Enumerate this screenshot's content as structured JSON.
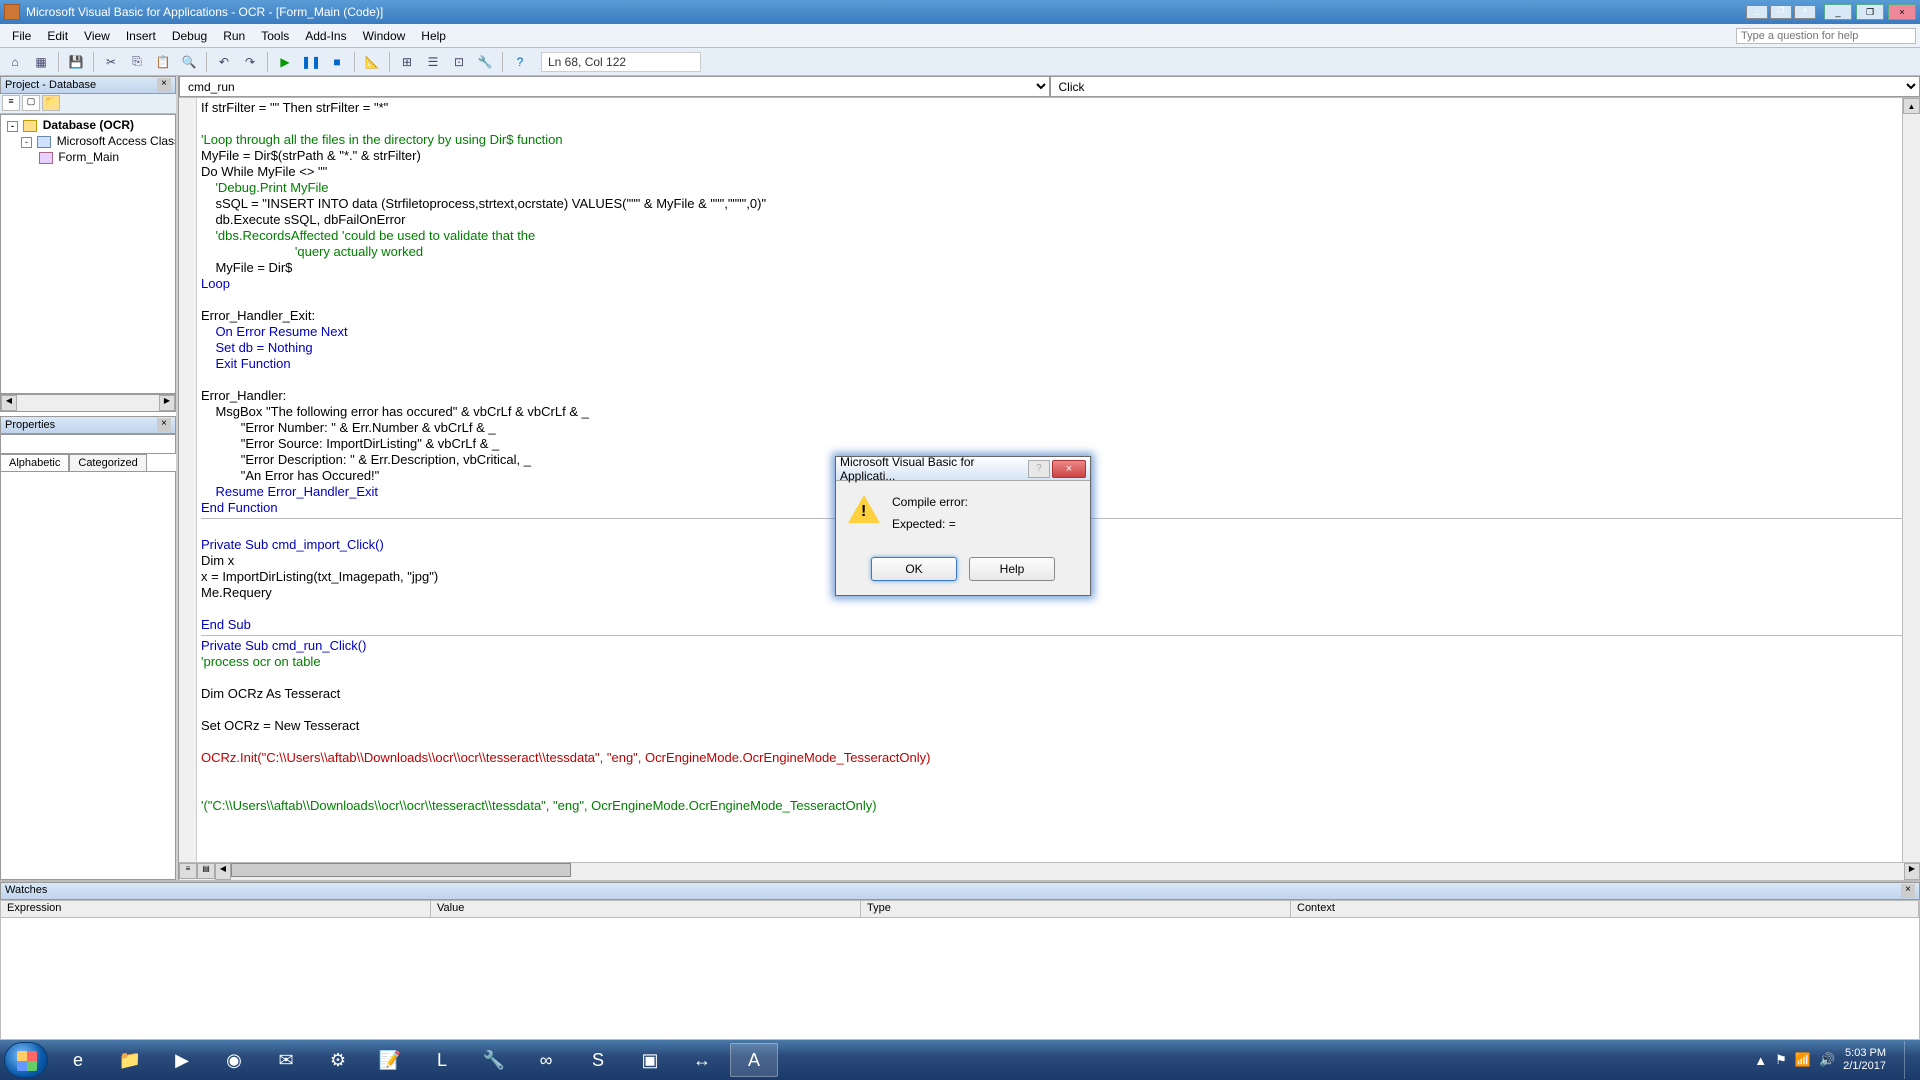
{
  "title": "Microsoft Visual Basic for Applications - OCR - [Form_Main (Code)]",
  "menu": [
    "File",
    "Edit",
    "View",
    "Insert",
    "Debug",
    "Run",
    "Tools",
    "Add-Ins",
    "Window",
    "Help"
  ],
  "help_placeholder": "Type a question for help",
  "cursor_pos": "Ln 68, Col 122",
  "project_panel_title": "Project - Database",
  "project_tree": {
    "root": "Database (OCR)",
    "group": "Microsoft Access Class Objects",
    "form": "Form_Main"
  },
  "properties_panel_title": "Properties",
  "prop_tabs": {
    "alphabetic": "Alphabetic",
    "categorized": "Categorized"
  },
  "code_dropdowns": {
    "object": "cmd_run",
    "procedure": "Click"
  },
  "code_lines": [
    {
      "cls": "",
      "t": "If strFilter = \"\" Then strFilter = \"*\""
    },
    {
      "cls": "",
      "t": ""
    },
    {
      "cls": "cm",
      "t": "'Loop through all the files in the directory by using Dir$ function"
    },
    {
      "cls": "",
      "t": "MyFile = Dir$(strPath & \"*.\" & strFilter)"
    },
    {
      "cls": "",
      "t": "Do While MyFile <> \"\""
    },
    {
      "cls": "cm",
      "t": "    'Debug.Print MyFile"
    },
    {
      "cls": "",
      "t": "    sSQL = \"INSERT INTO data (Strfiletoprocess,strtext,ocrstate) VALUES(\"\"\" & MyFile & \"\"\",\"\"\"\",0)\""
    },
    {
      "cls": "",
      "t": "    db.Execute sSQL, dbFailOnError"
    },
    {
      "cls": "cm",
      "t": "    'dbs.RecordsAffected 'could be used to validate that the"
    },
    {
      "cls": "cm",
      "t": "                          'query actually worked"
    },
    {
      "cls": "",
      "t": "    MyFile = Dir$"
    },
    {
      "cls": "kw",
      "t": "Loop"
    },
    {
      "cls": "",
      "t": ""
    },
    {
      "cls": "",
      "t": "Error_Handler_Exit:"
    },
    {
      "cls": "kw",
      "t": "    On Error Resume Next"
    },
    {
      "cls": "kw",
      "t": "    Set db = Nothing"
    },
    {
      "cls": "kw",
      "t": "    Exit Function"
    },
    {
      "cls": "",
      "t": ""
    },
    {
      "cls": "",
      "t": "Error_Handler:"
    },
    {
      "cls": "",
      "t": "    MsgBox \"The following error has occured\" & vbCrLf & vbCrLf & _"
    },
    {
      "cls": "",
      "t": "           \"Error Number: \" & Err.Number & vbCrLf & _"
    },
    {
      "cls": "",
      "t": "           \"Error Source: ImportDirListing\" & vbCrLf & _"
    },
    {
      "cls": "",
      "t": "           \"Error Description: \" & Err.Description, vbCritical, _"
    },
    {
      "cls": "",
      "t": "           \"An Error has Occured!\""
    },
    {
      "cls": "kw",
      "t": "    Resume Error_Handler_Exit"
    },
    {
      "cls": "kw",
      "t": "End Function"
    },
    {
      "cls": "sep",
      "t": ""
    },
    {
      "cls": "",
      "t": ""
    },
    {
      "cls": "kw",
      "t": "Private Sub cmd_import_Click()"
    },
    {
      "cls": "",
      "t": "Dim x"
    },
    {
      "cls": "",
      "t": "x = ImportDirListing(txt_Imagepath, \"jpg\")"
    },
    {
      "cls": "",
      "t": "Me.Requery"
    },
    {
      "cls": "",
      "t": ""
    },
    {
      "cls": "kw",
      "t": "End Sub"
    },
    {
      "cls": "sep",
      "t": ""
    },
    {
      "cls": "kw",
      "t": "Private Sub cmd_run_Click()"
    },
    {
      "cls": "cm",
      "t": "'process ocr on table"
    },
    {
      "cls": "",
      "t": ""
    },
    {
      "cls": "",
      "t": "Dim OCRz As Tesseract"
    },
    {
      "cls": "",
      "t": ""
    },
    {
      "cls": "",
      "t": "Set OCRz = New Tesseract"
    },
    {
      "cls": "",
      "t": ""
    },
    {
      "cls": "er",
      "t": "OCRz.Init(\"C:\\\\Users\\\\aftab\\\\Downloads\\\\ocr\\\\ocr\\\\tesseract\\\\tessdata\", \"eng\", OcrEngineMode.OcrEngineMode_TesseractOnly)"
    },
    {
      "cls": "",
      "t": ""
    },
    {
      "cls": "",
      "t": ""
    },
    {
      "cls": "cm",
      "t": "'(\"C:\\\\Users\\\\aftab\\\\Downloads\\\\ocr\\\\ocr\\\\tesseract\\\\tessdata\", \"eng\", OcrEngineMode.OcrEngineMode_TesseractOnly)"
    }
  ],
  "watches": {
    "title": "Watches",
    "cols": {
      "expression": "Expression",
      "value": "Value",
      "type": "Type",
      "context": "Context"
    }
  },
  "dialog": {
    "title": "Microsoft Visual Basic for Applicati...",
    "msg1": "Compile error:",
    "msg2": "Expected: =",
    "ok": "OK",
    "help": "Help"
  },
  "clock": {
    "time": "5:03 PM",
    "date": "2/1/2017"
  }
}
